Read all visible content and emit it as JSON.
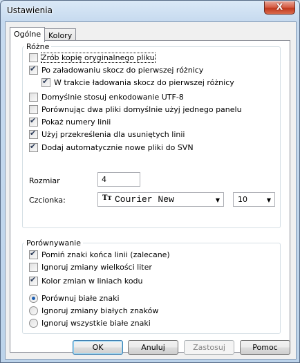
{
  "window": {
    "title": "Ustawienia",
    "close_glyph": "X"
  },
  "tabs": [
    {
      "label": "Ogólne",
      "active": true
    },
    {
      "label": "Kolory",
      "active": false
    }
  ],
  "misc_group": {
    "title": "Różne",
    "checkboxes": [
      {
        "label": "Zrób kopię oryginalnego pliku",
        "checked": false
      },
      {
        "label": "Po załadowaniu skocz do pierwszej różnicy",
        "checked": true
      },
      {
        "label": "W trakcie ładowania skocz do pierwszej różnicy",
        "checked": true
      },
      {
        "label": "Domyślnie stosuj enkodowanie UTF-8",
        "checked": false
      },
      {
        "label": "Porównując dwa pliki domyślnie użyj jednego panelu",
        "checked": false
      },
      {
        "label": "Pokaż numery linii",
        "checked": true
      },
      {
        "label": "Użyj przekreślenia dla usuniętych linii",
        "checked": true
      },
      {
        "label": "Dodaj automatycznie nowe pliki do SVN",
        "checked": true
      }
    ],
    "size_label": "Rozmiar",
    "size_value": "4",
    "font_label": "Czcionka:",
    "font_value": "Courier New",
    "font_icon": "truetype-font-icon",
    "font_size_value": "10"
  },
  "compare_group": {
    "title": "Porównywanie",
    "checkboxes": [
      {
        "label": "Pomiń znaki końca linii (zalecane)",
        "checked": true
      },
      {
        "label": "Ignoruj zmiany wielkości liter",
        "checked": false
      },
      {
        "label": "Kolor zmian w liniach kodu",
        "checked": true
      }
    ],
    "radios": [
      {
        "label": "Porównuj białe znaki",
        "checked": true
      },
      {
        "label": "Ignoruj zmiany białych znaków",
        "checked": false
      },
      {
        "label": "Ignoruj wszystkie białe znaki",
        "checked": false
      }
    ]
  },
  "buttons": {
    "ok": "OK",
    "cancel": "Anuluj",
    "apply": "Zastosuj",
    "help": "Pomoc"
  }
}
